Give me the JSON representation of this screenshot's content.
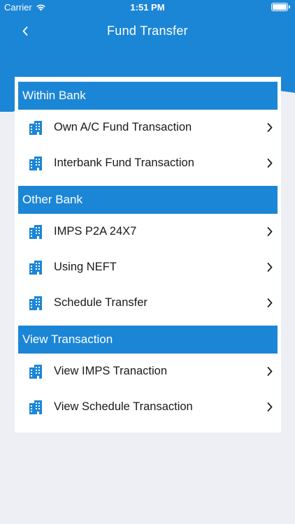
{
  "status_bar": {
    "carrier": "Carrier",
    "time": "1:51 PM"
  },
  "nav": {
    "title": "Fund Transfer",
    "back_icon": "chevron-left-icon"
  },
  "colors": {
    "primary": "#1c86d6",
    "background": "#eeeff4",
    "icon": "#1c86d6"
  },
  "sections": [
    {
      "title": "Within Bank",
      "items": [
        {
          "label": "Own A/C Fund Transaction",
          "icon": "building-icon"
        },
        {
          "label": "Interbank Fund Transaction",
          "icon": "building-icon"
        }
      ]
    },
    {
      "title": "Other Bank",
      "items": [
        {
          "label": "IMPS P2A 24X7",
          "icon": "building-icon"
        },
        {
          "label": "Using NEFT",
          "icon": "building-icon"
        },
        {
          "label": "Schedule Transfer",
          "icon": "building-icon"
        }
      ]
    },
    {
      "title": "View Transaction",
      "items": [
        {
          "label": "View IMPS Tranaction",
          "icon": "building-icon"
        },
        {
          "label": "View Schedule Transaction",
          "icon": "building-icon"
        }
      ]
    }
  ]
}
